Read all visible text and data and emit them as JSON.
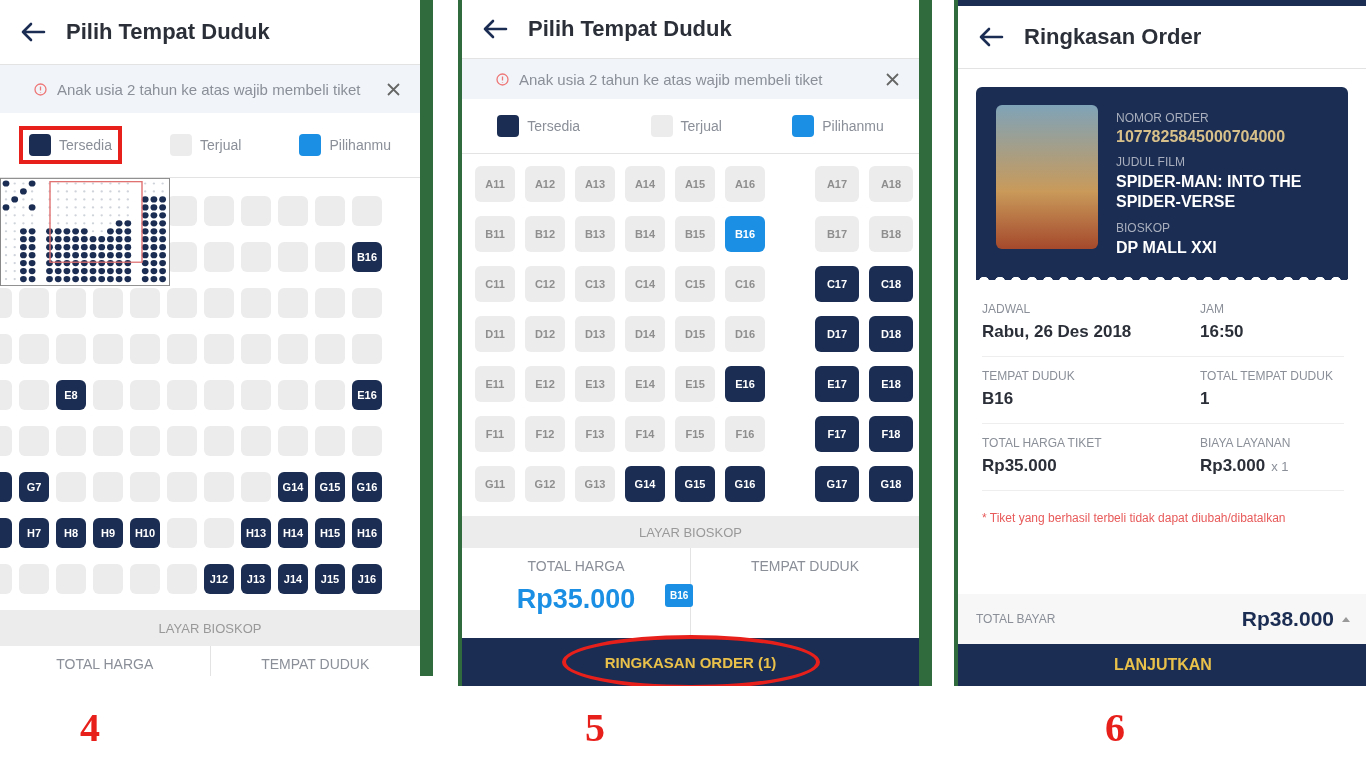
{
  "seat_selection_zoomed": {
    "step": "4",
    "title": "Pilih Tempat Duduk",
    "notice": "Anak usia 2 tahun ke atas wajib membeli tiket",
    "legend": [
      {
        "kind": "available",
        "label": "Tersedia",
        "annotated": true
      },
      {
        "kind": "sold",
        "label": "Terjual",
        "annotated": false
      },
      {
        "kind": "selected",
        "label": "Pilihanmu",
        "annotated": false
      }
    ],
    "seat_rows": [
      [
        {
          "available": false,
          "selected": false
        },
        {
          "available": false,
          "selected": false
        },
        {
          "available": false,
          "selected": false
        },
        {
          "available": false,
          "selected": false
        },
        {
          "available": false,
          "selected": false
        },
        {
          "available": false,
          "selected": false
        }
      ],
      [
        {
          "available": false,
          "selected": false
        },
        {
          "available": false,
          "selected": false
        },
        {
          "available": false,
          "selected": false
        },
        {
          "available": false,
          "selected": false
        },
        {
          "available": false,
          "selected": false
        },
        {
          "available": true,
          "selected": false,
          "label": "B16"
        }
      ],
      [
        {
          "available": false,
          "selected": false
        },
        {
          "available": false,
          "selected": false
        },
        {
          "available": false,
          "selected": false
        },
        {
          "available": false,
          "selected": false
        },
        {
          "available": false,
          "selected": false
        },
        {
          "available": false,
          "selected": false
        },
        {
          "available": false,
          "selected": false
        },
        {
          "available": false,
          "selected": false
        },
        {
          "available": false,
          "selected": false
        },
        {
          "available": false,
          "selected": false
        },
        {
          "available": false,
          "selected": false
        }
      ],
      [
        {
          "available": false,
          "selected": false
        },
        {
          "available": false,
          "selected": false
        },
        {
          "available": false,
          "selected": false
        },
        {
          "available": false,
          "selected": false
        },
        {
          "available": false,
          "selected": false
        },
        {
          "available": false,
          "selected": false
        },
        {
          "available": false,
          "selected": false
        },
        {
          "available": false,
          "selected": false
        },
        {
          "available": false,
          "selected": false
        },
        {
          "available": false,
          "selected": false
        },
        {
          "available": false,
          "selected": false
        }
      ],
      [
        {
          "available": false,
          "selected": false
        },
        {
          "available": false,
          "selected": false
        },
        {
          "available": true,
          "selected": false,
          "label": "E8"
        },
        {
          "available": false,
          "selected": false
        },
        {
          "available": false,
          "selected": false
        },
        {
          "available": false,
          "selected": false
        },
        {
          "available": false,
          "selected": false
        },
        {
          "available": false,
          "selected": false
        },
        {
          "available": false,
          "selected": false
        },
        {
          "available": false,
          "selected": false
        },
        {
          "available": true,
          "selected": false,
          "label": "E16"
        }
      ],
      [
        {
          "available": false,
          "selected": false
        },
        {
          "available": false,
          "selected": false
        },
        {
          "available": false,
          "selected": false
        },
        {
          "available": false,
          "selected": false
        },
        {
          "available": false,
          "selected": false
        },
        {
          "available": false,
          "selected": false
        },
        {
          "available": false,
          "selected": false
        },
        {
          "available": false,
          "selected": false
        },
        {
          "available": false,
          "selected": false
        },
        {
          "available": false,
          "selected": false
        },
        {
          "available": false,
          "selected": false
        }
      ],
      [
        {
          "available": true,
          "selected": false
        },
        {
          "available": true,
          "selected": false,
          "label": "G7"
        },
        {
          "available": false,
          "selected": false
        },
        {
          "available": false,
          "selected": false
        },
        {
          "available": false,
          "selected": false
        },
        {
          "available": false,
          "selected": false
        },
        {
          "available": false,
          "selected": false
        },
        {
          "available": false,
          "selected": false
        },
        {
          "available": true,
          "selected": false,
          "label": "G14"
        },
        {
          "available": true,
          "selected": false,
          "label": "G15"
        },
        {
          "available": true,
          "selected": false,
          "label": "G16"
        }
      ],
      [
        {
          "available": true,
          "selected": false
        },
        {
          "available": true,
          "selected": false,
          "label": "H7"
        },
        {
          "available": true,
          "selected": false,
          "label": "H8"
        },
        {
          "available": true,
          "selected": false,
          "label": "H9"
        },
        {
          "available": true,
          "selected": false,
          "label": "H10"
        },
        {
          "available": false,
          "selected": false
        },
        {
          "available": false,
          "selected": false
        },
        {
          "available": true,
          "selected": false,
          "label": "H13"
        },
        {
          "available": true,
          "selected": false,
          "label": "H14"
        },
        {
          "available": true,
          "selected": false,
          "label": "H15"
        },
        {
          "available": true,
          "selected": false,
          "label": "H16"
        }
      ],
      [
        {
          "available": false,
          "selected": false
        },
        {
          "available": false,
          "selected": false
        },
        {
          "available": false,
          "selected": false
        },
        {
          "available": false,
          "selected": false
        },
        {
          "available": false,
          "selected": false
        },
        {
          "available": false,
          "selected": false
        },
        {
          "available": true,
          "selected": false,
          "label": "J12"
        },
        {
          "available": true,
          "selected": false,
          "label": "J13"
        },
        {
          "available": true,
          "selected": false,
          "label": "J14"
        },
        {
          "available": true,
          "selected": false,
          "label": "J15"
        },
        {
          "available": true,
          "selected": false,
          "label": "J16"
        }
      ]
    ],
    "screen_label": "LAYAR BIOSKOP",
    "summary_labels": [
      "TOTAL HARGA",
      "TEMPAT DUDUK"
    ]
  },
  "seat_selection": {
    "step": "5",
    "title": "Pilih Tempat Duduk",
    "notice": "Anak usia 2 tahun ke atas wajib membeli tiket",
    "legend": [
      {
        "kind": "available",
        "label": "Tersedia",
        "annotated": false
      },
      {
        "kind": "sold",
        "label": "Terjual",
        "annotated": false
      },
      {
        "kind": "selected",
        "label": "Pilihanmu",
        "annotated": false
      }
    ],
    "seat_rows": [
      {
        "left": [
          {
            "available": false,
            "selected": false,
            "label": "A11"
          },
          {
            "available": false,
            "selected": false,
            "label": "A12"
          },
          {
            "available": false,
            "selected": false,
            "label": "A13"
          },
          {
            "available": false,
            "selected": false,
            "label": "A14"
          },
          {
            "available": false,
            "selected": false,
            "label": "A15"
          },
          {
            "available": false,
            "selected": false,
            "label": "A16"
          }
        ],
        "right": [
          {
            "available": false,
            "selected": false,
            "label": "A17"
          },
          {
            "available": false,
            "selected": false,
            "label": "A18"
          }
        ]
      },
      {
        "left": [
          {
            "available": false,
            "selected": false,
            "label": "B11"
          },
          {
            "available": false,
            "selected": false,
            "label": "B12"
          },
          {
            "available": false,
            "selected": false,
            "label": "B13"
          },
          {
            "available": false,
            "selected": false,
            "label": "B14"
          },
          {
            "available": false,
            "selected": false,
            "label": "B15"
          },
          {
            "available": true,
            "selected": true,
            "label": "B16"
          }
        ],
        "right": [
          {
            "available": false,
            "selected": false,
            "label": "B17"
          },
          {
            "available": false,
            "selected": false,
            "label": "B18"
          }
        ]
      },
      {
        "left": [
          {
            "available": false,
            "selected": false,
            "label": "C11"
          },
          {
            "available": false,
            "selected": false,
            "label": "C12"
          },
          {
            "available": false,
            "selected": false,
            "label": "C13"
          },
          {
            "available": false,
            "selected": false,
            "label": "C14"
          },
          {
            "available": false,
            "selected": false,
            "label": "C15"
          },
          {
            "available": false,
            "selected": false,
            "label": "C16"
          }
        ],
        "right": [
          {
            "available": true,
            "selected": false,
            "label": "C17"
          },
          {
            "available": true,
            "selected": false,
            "label": "C18"
          }
        ]
      },
      {
        "left": [
          {
            "available": false,
            "selected": false,
            "label": "D11"
          },
          {
            "available": false,
            "selected": false,
            "label": "D12"
          },
          {
            "available": false,
            "selected": false,
            "label": "D13"
          },
          {
            "available": false,
            "selected": false,
            "label": "D14"
          },
          {
            "available": false,
            "selected": false,
            "label": "D15"
          },
          {
            "available": false,
            "selected": false,
            "label": "D16"
          }
        ],
        "right": [
          {
            "available": true,
            "selected": false,
            "label": "D17"
          },
          {
            "available": true,
            "selected": false,
            "label": "D18"
          }
        ]
      },
      {
        "left": [
          {
            "available": false,
            "selected": false,
            "label": "E11"
          },
          {
            "available": false,
            "selected": false,
            "label": "E12"
          },
          {
            "available": false,
            "selected": false,
            "label": "E13"
          },
          {
            "available": false,
            "selected": false,
            "label": "E14"
          },
          {
            "available": false,
            "selected": false,
            "label": "E15"
          },
          {
            "available": true,
            "selected": false,
            "label": "E16"
          }
        ],
        "right": [
          {
            "available": true,
            "selected": false,
            "label": "E17"
          },
          {
            "available": true,
            "selected": false,
            "label": "E18"
          }
        ]
      },
      {
        "left": [
          {
            "available": false,
            "selected": false,
            "label": "F11"
          },
          {
            "available": false,
            "selected": false,
            "label": "F12"
          },
          {
            "available": false,
            "selected": false,
            "label": "F13"
          },
          {
            "available": false,
            "selected": false,
            "label": "F14"
          },
          {
            "available": false,
            "selected": false,
            "label": "F15"
          },
          {
            "available": false,
            "selected": false,
            "label": "F16"
          }
        ],
        "right": [
          {
            "available": true,
            "selected": false,
            "label": "F17"
          },
          {
            "available": true,
            "selected": false,
            "label": "F18"
          }
        ]
      },
      {
        "left": [
          {
            "available": false,
            "selected": false,
            "label": "G11"
          },
          {
            "available": false,
            "selected": false,
            "label": "G12"
          },
          {
            "available": false,
            "selected": false,
            "label": "G13"
          },
          {
            "available": true,
            "selected": false,
            "label": "G14"
          },
          {
            "available": true,
            "selected": false,
            "label": "G15"
          },
          {
            "available": true,
            "selected": false,
            "label": "G16"
          }
        ],
        "right": [
          {
            "available": true,
            "selected": false,
            "label": "G17"
          },
          {
            "available": true,
            "selected": false,
            "label": "G18"
          }
        ]
      }
    ],
    "screen_label": "LAYAR BIOSKOP",
    "total_label": "TOTAL HARGA",
    "total": "Rp35.000",
    "seats_label": "TEMPAT DUDUK",
    "chosen_seats": [
      "B16"
    ],
    "order_button": {
      "label": "RINGKASAN ORDER (1)",
      "annotated": true
    }
  },
  "order_summary": {
    "step": "6",
    "title": "Ringkasan Order",
    "ticket": {
      "order_number_label": "NOMOR ORDER",
      "order_number": "1077825845000704000",
      "film_label": "JUDUL FILM",
      "film": "SPIDER-MAN: INTO THE SPIDER-VERSE",
      "cinema_label": "BIOSKOP",
      "cinema": "DP MALL XXI"
    },
    "details": [
      [
        {
          "label": "JADWAL",
          "value": "Rabu, 26 Des 2018"
        },
        {
          "label": "JAM",
          "value": "16:50"
        }
      ],
      [
        {
          "label": "TEMPAT DUDUK",
          "value": "B16"
        },
        {
          "label": "TOTAL TEMPAT DUDUK",
          "value": "1"
        }
      ],
      [
        {
          "label": "TOTAL HARGA TIKET",
          "value": "Rp35.000"
        },
        {
          "label": "BIAYA LAYANAN",
          "value": "Rp3.000",
          "multiplier": "x 1"
        }
      ]
    ],
    "note": "* Tiket yang berhasil terbeli tidak dapat diubah/dibatalkan",
    "total_label": "TOTAL BAYAR",
    "total": "Rp38.000",
    "button": "LANJUTKAN"
  }
}
